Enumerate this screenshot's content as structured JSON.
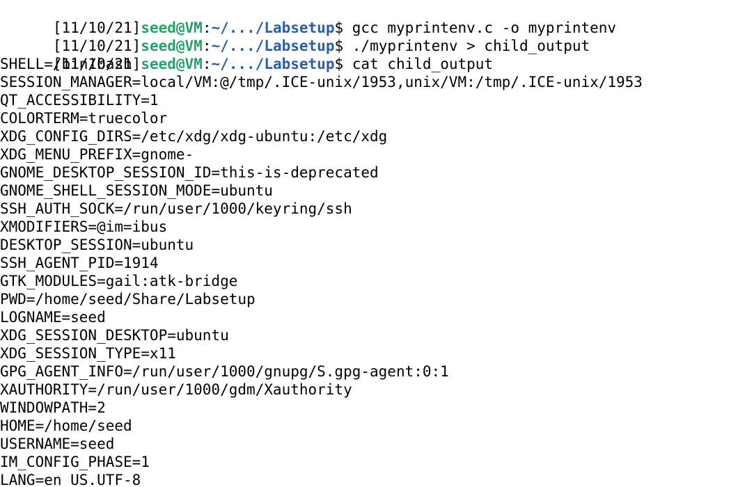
{
  "terminal": {
    "colors": {
      "background": "#ffffff",
      "text": "#000000",
      "prompt_user": "#26a269",
      "prompt_path": "#2a5db0"
    },
    "commands": [
      {
        "date": "[11/10/21]",
        "user_host": "seed@VM",
        "separator": ":",
        "path": "~/.../Labsetup",
        "symbol": "$ ",
        "command": "gcc myprintenv.c -o myprintenv"
      },
      {
        "date": "[11/10/21]",
        "user_host": "seed@VM",
        "separator": ":",
        "path": "~/.../Labsetup",
        "symbol": "$ ",
        "command": "./myprintenv > child_output"
      },
      {
        "date": "[11/10/21]",
        "user_host": "seed@VM",
        "separator": ":",
        "path": "~/.../Labsetup",
        "symbol": "$ ",
        "command": "cat child_output"
      }
    ],
    "output": [
      "SHELL=/bin/bash",
      "SESSION_MANAGER=local/VM:@/tmp/.ICE-unix/1953,unix/VM:/tmp/.ICE-unix/1953",
      "QT_ACCESSIBILITY=1",
      "COLORTERM=truecolor",
      "XDG_CONFIG_DIRS=/etc/xdg/xdg-ubuntu:/etc/xdg",
      "XDG_MENU_PREFIX=gnome-",
      "GNOME_DESKTOP_SESSION_ID=this-is-deprecated",
      "GNOME_SHELL_SESSION_MODE=ubuntu",
      "SSH_AUTH_SOCK=/run/user/1000/keyring/ssh",
      "XMODIFIERS=@im=ibus",
      "DESKTOP_SESSION=ubuntu",
      "SSH_AGENT_PID=1914",
      "GTK_MODULES=gail:atk-bridge",
      "PWD=/home/seed/Share/Labsetup",
      "LOGNAME=seed",
      "XDG_SESSION_DESKTOP=ubuntu",
      "XDG_SESSION_TYPE=x11",
      "GPG_AGENT_INFO=/run/user/1000/gnupg/S.gpg-agent:0:1",
      "XAUTHORITY=/run/user/1000/gdm/Xauthority",
      "WINDOWPATH=2",
      "HOME=/home/seed",
      "USERNAME=seed",
      "IM_CONFIG_PHASE=1",
      "LANG=en_US.UTF-8"
    ]
  }
}
